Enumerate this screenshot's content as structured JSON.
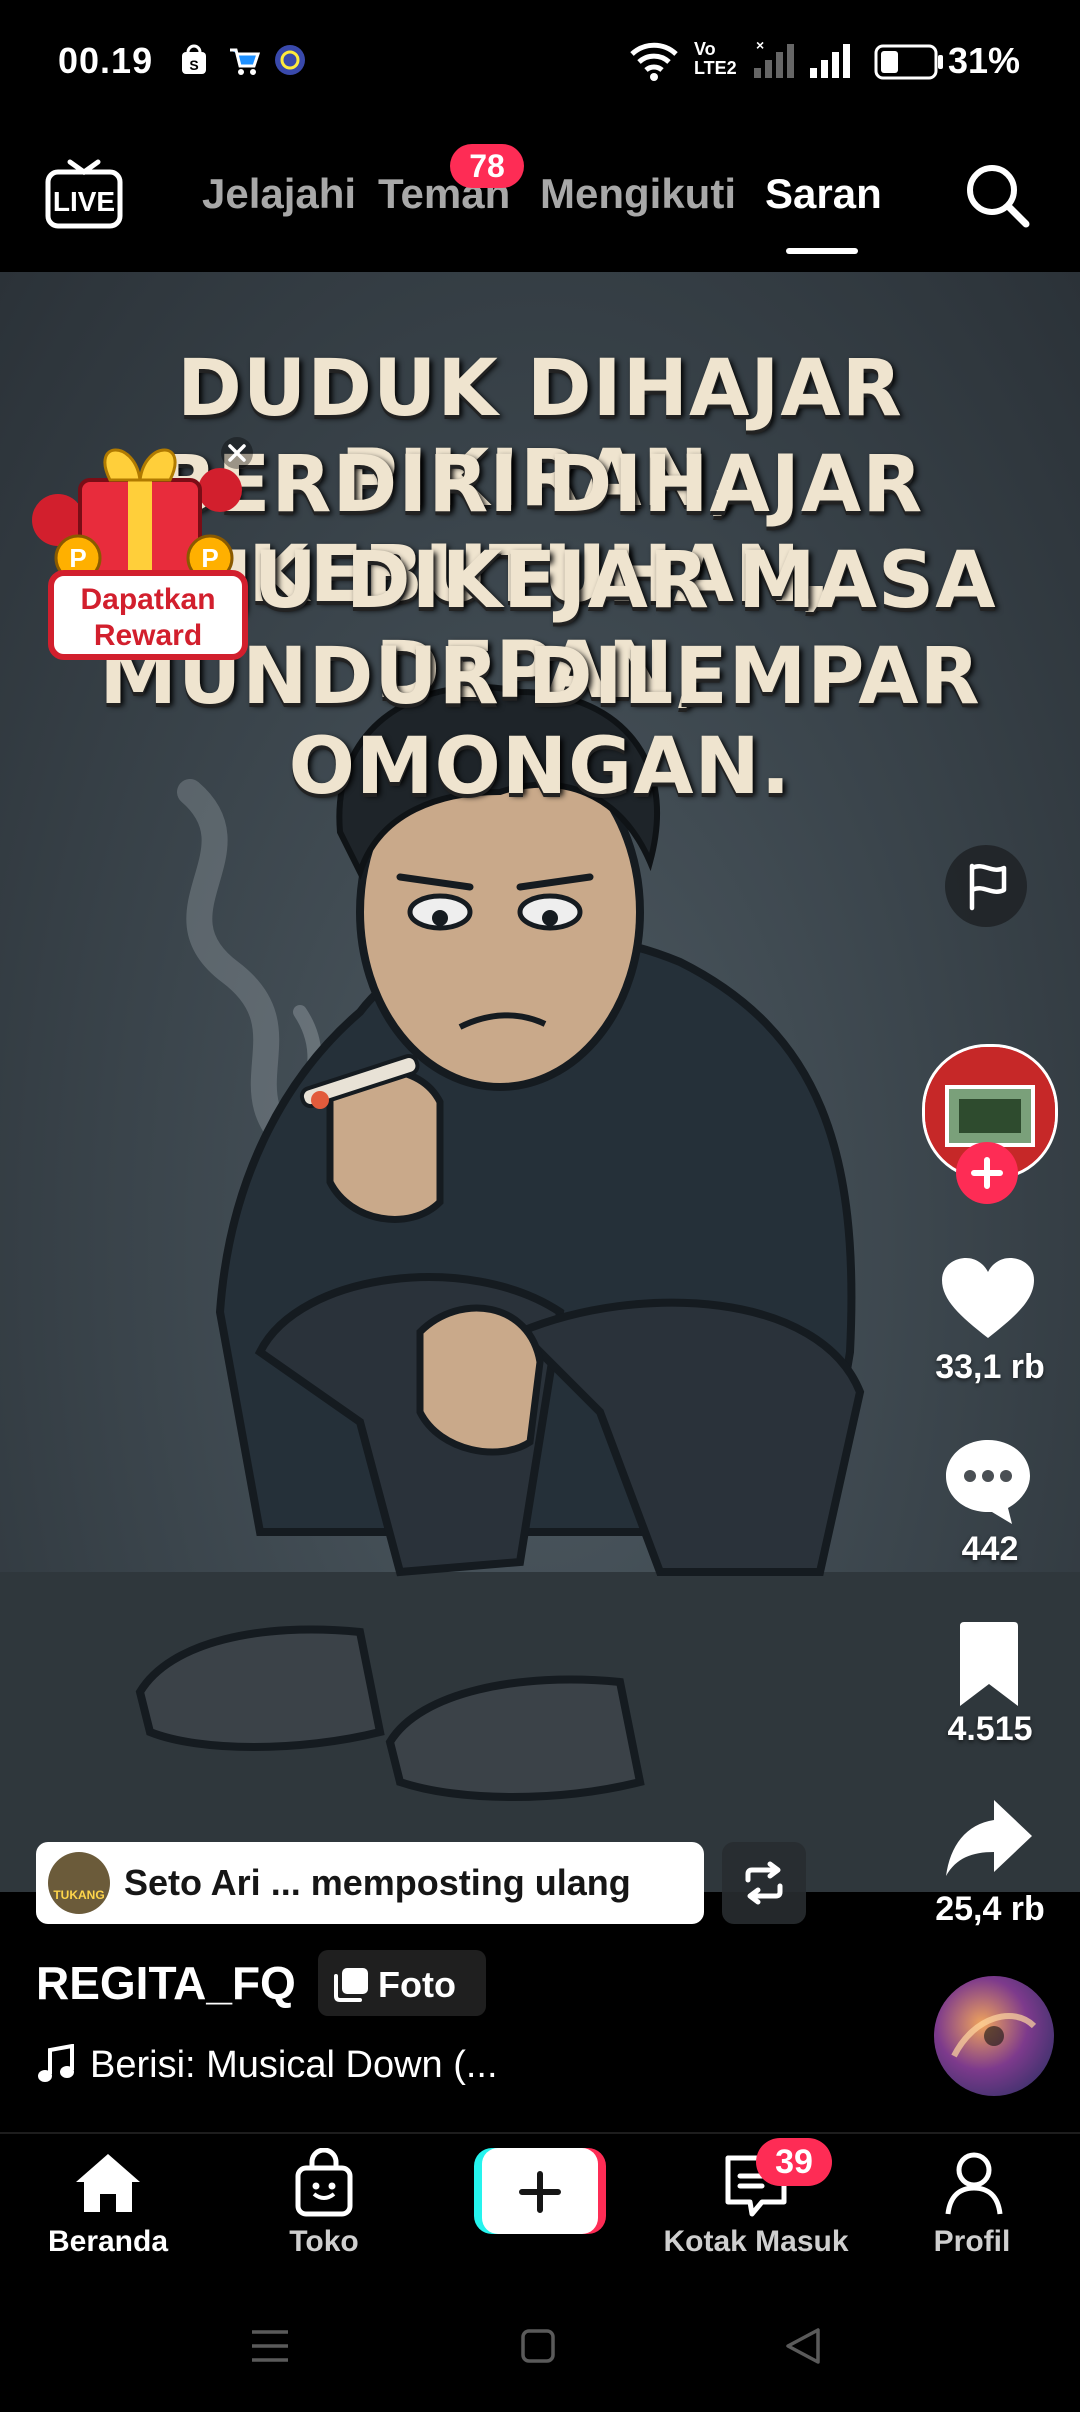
{
  "status_bar": {
    "time": "00.19",
    "network_label": "Vo LTE2",
    "battery": "31%"
  },
  "top_nav": {
    "live_label": "LIVE",
    "tabs": [
      {
        "label": "Jelajahi"
      },
      {
        "label": "Teman",
        "badge": "78"
      },
      {
        "label": "Mengikuti"
      },
      {
        "label": "Saran"
      }
    ],
    "active_tab": "Saran"
  },
  "post": {
    "caption_lines": [
      "DUDUK DIHAJAR PIKIRAN,",
      "BERDIRI DIHAJAR KEBUTUHAN,",
      "MAJU DIKEJAR MASA DEPAN,",
      "MUNDUR DILEMPAR OMONGAN."
    ],
    "reward_label_1": "Dapatkan",
    "reward_label_2": "Reward",
    "repost_text": "Seto Ari ... memposting ulang",
    "repost_avatar_text": "TUKANG",
    "username": "REGITA_FQ",
    "type_label": "Foto",
    "music": "Berisi: Musical Down (..."
  },
  "actions": {
    "likes": "33,1 rb",
    "comments": "442",
    "saves": "4.515",
    "shares": "25,4 rb"
  },
  "bottom_nav": {
    "items": [
      {
        "label": "Beranda"
      },
      {
        "label": "Toko"
      },
      {
        "label": ""
      },
      {
        "label": "Kotak Masuk",
        "badge": "39"
      },
      {
        "label": "Profil"
      }
    ]
  },
  "colors": {
    "accent": "#fe2c55",
    "caption": "#efe4cf",
    "media_bg": "#3a444b"
  }
}
